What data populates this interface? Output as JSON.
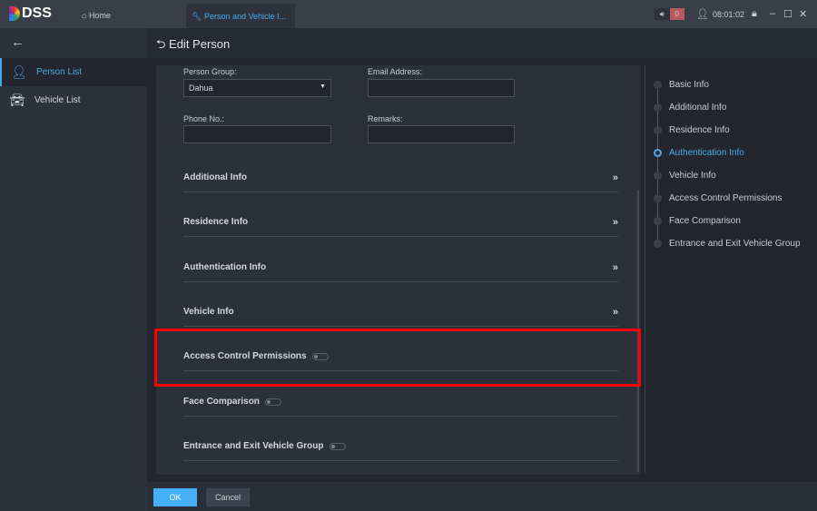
{
  "app": {
    "logo": "DSS",
    "home_tab": "Home",
    "active_tab": "Person and Vehicle I...",
    "alarm_count": "0",
    "time": "08:01:02"
  },
  "sidebar": {
    "items": [
      {
        "label": "Person List"
      },
      {
        "label": "Vehicle List"
      }
    ]
  },
  "header": {
    "title": "Edit Person"
  },
  "form": {
    "person_group_label": "Person Group:",
    "person_group_value": "Dahua",
    "email_label": "Email Address:",
    "email_value": "",
    "phone_label": "Phone No.:",
    "phone_value": "",
    "remarks_label": "Remarks:",
    "remarks_value": ""
  },
  "sections": [
    {
      "label": "Additional Info"
    },
    {
      "label": "Residence Info"
    },
    {
      "label": "Authentication Info"
    },
    {
      "label": "Vehicle Info"
    },
    {
      "label": "Access Control Permissions",
      "enabled": false
    },
    {
      "label": "Face Comparison",
      "enabled": false
    },
    {
      "label": "Entrance and Exit Vehicle Group",
      "enabled": false
    }
  ],
  "steps": [
    {
      "label": "Basic Info"
    },
    {
      "label": "Additional Info"
    },
    {
      "label": "Residence Info"
    },
    {
      "label": "Authentication Info",
      "active": true
    },
    {
      "label": "Vehicle Info"
    },
    {
      "label": "Access Control Permissions"
    },
    {
      "label": "Face Comparison"
    },
    {
      "label": "Entrance and Exit Vehicle Group"
    }
  ],
  "footer": {
    "ok": "OK",
    "cancel": "Cancel"
  },
  "colors": {
    "accent": "#4aa8e8",
    "highlight": "#ff0000"
  }
}
